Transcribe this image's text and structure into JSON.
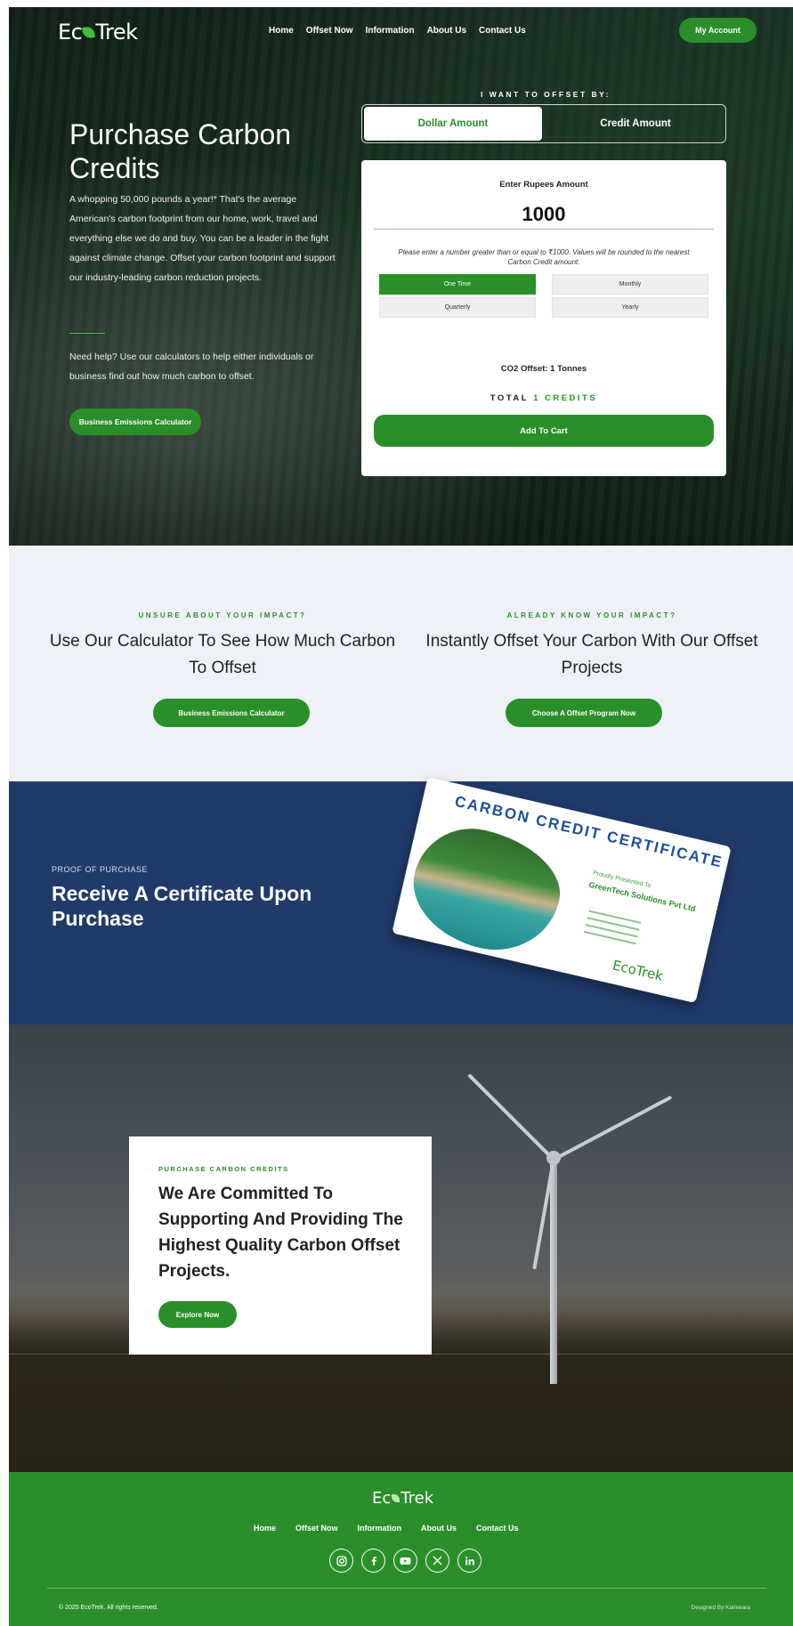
{
  "colors": {
    "brand_green": "#2a8f2a",
    "navy": "#203a6a",
    "light_bg": "#eef1f7"
  },
  "nav": {
    "logo_left": "Ec",
    "logo_right": "Trek",
    "links": [
      "Home",
      "Offset Now",
      "Information",
      "About Us",
      "Contact Us"
    ],
    "account_button": "My Account"
  },
  "hero": {
    "title": "Purchase Carbon Credits",
    "paragraph1": "A whopping 50,000 pounds a year!* That's the average American's carbon footprint from our home, work, travel and everything else we do and buy. You can be a leader in the fight against climate change. Offset your carbon footprint and support our industry-leading carbon reduction projects.",
    "paragraph2": "Need help? Use our calculators to help either individuals or business find out how much carbon to offset.",
    "calc_button": "Business Emissions Calculator"
  },
  "offset": {
    "label": "I WANT TO OFFSET BY:",
    "option_dollar": "Dollar Amount",
    "option_credit": "Credit Amount",
    "enter_label": "Enter Rupees Amount",
    "amount_value": "1000",
    "note": "Please enter a number greater than or equal to ₹1000. Values will be rounded to the nearest Carbon Credit amount.",
    "frequencies": [
      "One Time",
      "Monthly",
      "Quarterly",
      "Yearly"
    ],
    "selected_frequency": "One Time",
    "co2": "CO2 Offset: 1 Tonnes",
    "total_label": "TOTAL",
    "total_value": "1 CREDITS",
    "add_button": "Add To Cart"
  },
  "calc_section": {
    "left": {
      "kicker": "UNSURE ABOUT YOUR IMPACT?",
      "heading": "Use Our Calculator To See How Much Carbon To Offset",
      "button": "Business Emissions Calculator"
    },
    "right": {
      "kicker": "ALREADY KNOW YOUR IMPACT?",
      "heading": "Instantly Offset Your Carbon With Our Offset Projects",
      "button": "Choose A Offset Program Now"
    }
  },
  "certificate": {
    "kicker": "PROOF OF PURCHASE",
    "title": "Receive A Certificate Upon Purchase",
    "card_title": "CARBON CREDIT CERTIFICATE",
    "card_presented": "Proudly Presented To",
    "card_company": "GreenTech Solutions Pvt Ltd",
    "card_logo": "EcoTrek"
  },
  "commit": {
    "kicker": "PURCHASE CARBON CREDITS",
    "heading": "We Are Committed To Supporting And Providing The Highest Quality Carbon Offset Projects.",
    "button": "Explore Now"
  },
  "footer": {
    "logo_left": "Ec",
    "logo_right": "Trek",
    "links": [
      "Home",
      "Offset Now",
      "Information",
      "About Us",
      "Contact Us"
    ],
    "social_icons": [
      "instagram-icon",
      "facebook-icon",
      "youtube-icon",
      "x-icon",
      "linkedin-icon"
    ],
    "copyright": "© 2025 EcoTrek. All rights reserved.",
    "designed_by": "Designed By Kalmeara"
  }
}
